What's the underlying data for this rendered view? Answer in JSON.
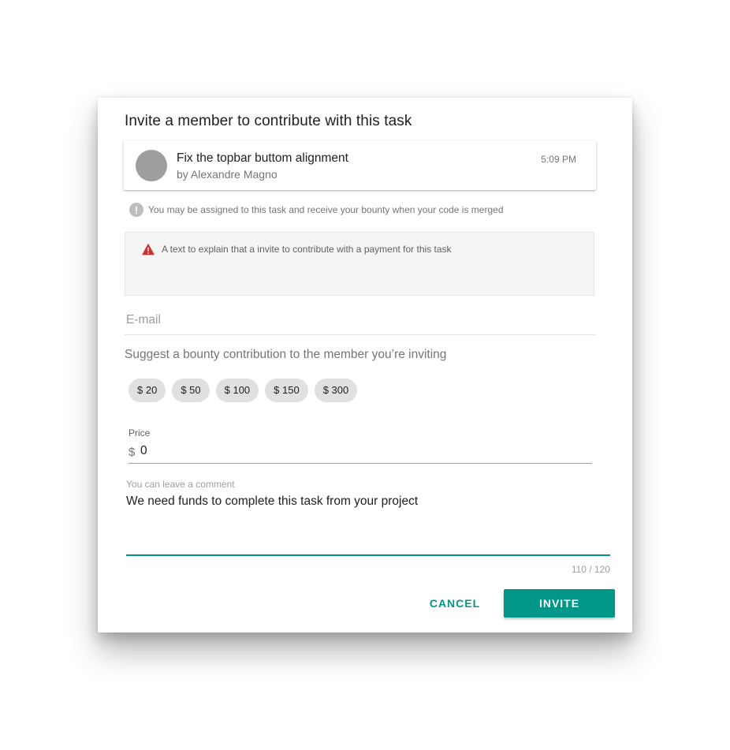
{
  "dialog": {
    "title": "Invite a member to contribute with this task"
  },
  "task": {
    "title": "Fix the topbar buttom alignment",
    "author": "by Alexandre Magno",
    "time": "5:09 PM"
  },
  "info": {
    "icon": "exclamation-circle-icon",
    "text": "You may be assigned to this task and receive your bounty when your code is merged"
  },
  "warning": {
    "icon": "warning-triangle-icon",
    "color": "#d32f2f",
    "text": "A text to explain that a invite to contribute with a payment for this task"
  },
  "email": {
    "placeholder": "E-mail",
    "value": ""
  },
  "bounty": {
    "label": "Suggest a bounty contribution to the member you’re inviting",
    "options": [
      "$ 20",
      "$ 50",
      "$ 100",
      "$ 150",
      "$ 300"
    ]
  },
  "price": {
    "label": "Price",
    "prefix": "$",
    "value": "0"
  },
  "comment": {
    "label": "You can leave a comment",
    "value": "We need funds to complete this task from your project",
    "counter": "110 / 120"
  },
  "actions": {
    "cancel": "CANCEL",
    "invite": "INVITE"
  },
  "colors": {
    "accent": "#009688",
    "avatar": "#9e9e9e",
    "chip": "#e0e0e0"
  }
}
